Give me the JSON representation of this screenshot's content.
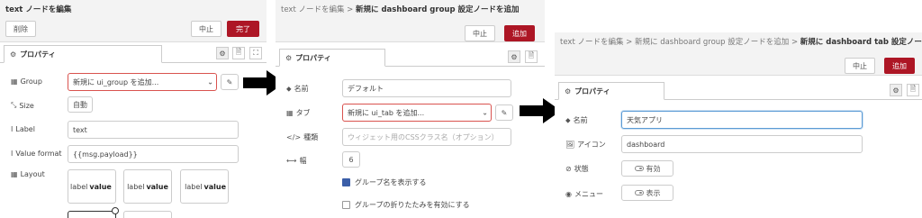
{
  "panel1": {
    "title": "text ノードを編集",
    "delete_label": "削除",
    "cancel_label": "中止",
    "done_label": "完了",
    "tab_label": "プロパティ",
    "group_label": "Group",
    "group_value": "新規に ui_group を追加...",
    "size_label": "Size",
    "size_value": "自動",
    "label_label": "Label",
    "label_value": "text",
    "value_format_label": "Value format",
    "value_format_value": "{{msg.payload}}",
    "layout_label": "Layout",
    "layout_card_label": "label",
    "layout_card_value": "value"
  },
  "panel2": {
    "breadcrumb": "text ノードを編集 >",
    "title": "新規に dashboard group 設定ノードを追加",
    "cancel_label": "中止",
    "add_label": "追加",
    "tab_label": "プロパティ",
    "name_label": "名前",
    "name_value": "デフォルト",
    "tab_field_label": "タブ",
    "tab_value": "新規に ui_tab を追加...",
    "class_label": "種類",
    "class_placeholder": "ウィジェット用のCSSクラス名（オプション）",
    "width_label": "幅",
    "width_value": "6",
    "show_name_label": "グループ名を表示する",
    "collapse_label": "グループの折りたたみを有効にする"
  },
  "panel3": {
    "breadcrumb": "text ノードを編集 > 新規に dashboard group 設定ノードを追加 >",
    "title": "新規に dashboard tab 設定ノードを追加",
    "cancel_label": "中止",
    "add_label": "追加",
    "tab_label": "プロパティ",
    "name_label": "名前",
    "name_value": "天気アプリ",
    "icon_label": "アイコン",
    "icon_value": "dashboard",
    "state_label": "状態",
    "state_value": "有効",
    "menu_label": "メニュー",
    "menu_value": "表示"
  },
  "colors": {
    "primary": "#ad1625",
    "checkbox": "#3b5ea8",
    "arrow": "#000000"
  }
}
